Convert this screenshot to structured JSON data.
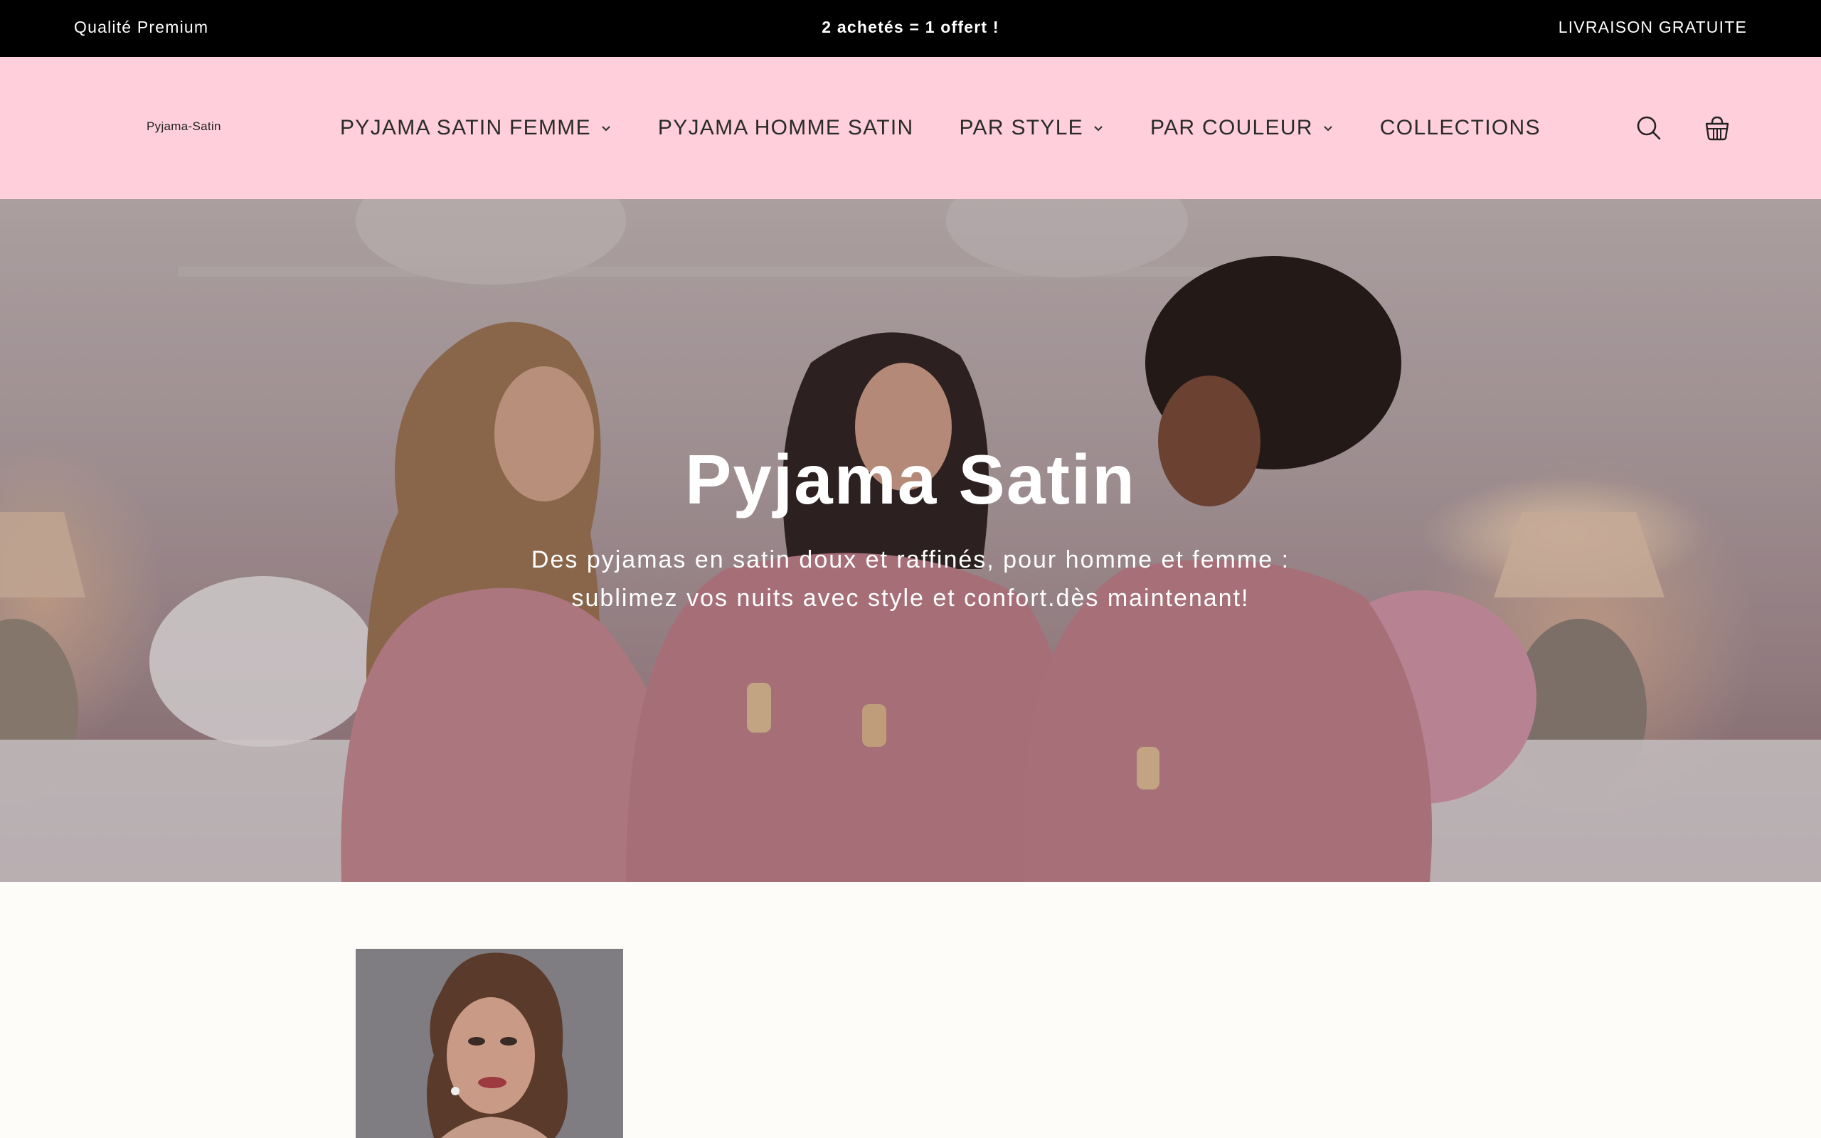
{
  "announcement": {
    "left": "Qualité Premium",
    "center": "2 achetés = 1 offert !",
    "right": "LIVRAISON GRATUITE"
  },
  "header": {
    "logo": "Pyjama-Satin",
    "nav": [
      {
        "label": "PYJAMA SATIN FEMME",
        "dropdown": true
      },
      {
        "label": "PYJAMA HOMME SATIN",
        "dropdown": false
      },
      {
        "label": "PAR STYLE",
        "dropdown": true
      },
      {
        "label": "PAR COULEUR",
        "dropdown": true
      },
      {
        "label": "COLLECTIONS",
        "dropdown": false
      }
    ],
    "icons": [
      "search-icon",
      "cart-icon"
    ]
  },
  "hero": {
    "title": "Pyjama Satin",
    "subtitle": "Des pyjamas en satin doux et raffinés, pour homme et femme : sublimez vos nuits avec style et confort.dès maintenant!"
  },
  "colors": {
    "topbar": "#000000",
    "header": "#ffcfdb",
    "page": "#fdfcf8",
    "robe": "#c98a92"
  }
}
